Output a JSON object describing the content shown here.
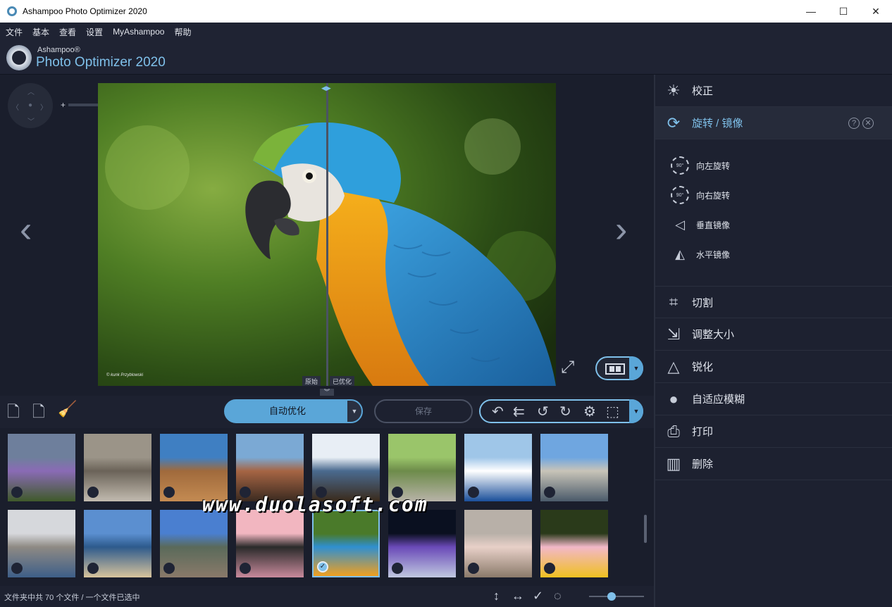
{
  "window": {
    "title": "Ashampoo Photo Optimizer 2020",
    "controls": [
      "—",
      "☐",
      "✕"
    ]
  },
  "menu": [
    "文件",
    "基本",
    "查看",
    "设置",
    "MyAshampoo",
    "帮助"
  ],
  "brand": {
    "small": "Ashampoo®",
    "big": "Photo Optimizer 2020"
  },
  "viewer": {
    "label_original": "原始",
    "label_optimized": "已优化",
    "credit": "© kunk Przyblowski",
    "zoom_plus": "+",
    "zoom_minus": "−",
    "zoom_level": 0.4
  },
  "toolbar": {
    "auto_label": "自动优化",
    "save_label": "保存"
  },
  "thumbnails": [
    {
      "name": "thumb-village-flowers",
      "colors": [
        "#6e7f9c",
        "#8a6bb5",
        "#3f5a2a"
      ]
    },
    {
      "name": "thumb-monkeys",
      "colors": [
        "#9b9488",
        "#6b6358",
        "#c2bbb0"
      ]
    },
    {
      "name": "thumb-horses-desert",
      "colors": [
        "#3f7fc2",
        "#a06a3c",
        "#c48b52"
      ]
    },
    {
      "name": "thumb-donkey-pack",
      "colors": [
        "#7ba9d4",
        "#a66544",
        "#3a2a20"
      ]
    },
    {
      "name": "thumb-greek-horses",
      "colors": [
        "#e8eef5",
        "#4a6a8f",
        "#3a2a1a"
      ]
    },
    {
      "name": "thumb-path-trees",
      "colors": [
        "#9ac56a",
        "#6d8b4a",
        "#b8b3a8"
      ]
    },
    {
      "name": "thumb-blue-dome",
      "colors": [
        "#9fc6e8",
        "#ffffff",
        "#1a4f9a"
      ]
    },
    {
      "name": "thumb-old-truck",
      "colors": [
        "#6fa6e0",
        "#c8c4b8",
        "#4a5a6a"
      ]
    },
    {
      "name": "thumb-colonial-building",
      "colors": [
        "#d6d8dc",
        "#8e8a84",
        "#3e5f88"
      ]
    },
    {
      "name": "thumb-blue-car",
      "colors": [
        "#5b8fd0",
        "#2d5a8c",
        "#d8c49c"
      ]
    },
    {
      "name": "thumb-green-truck",
      "colors": [
        "#4a7fd0",
        "#5a6a5a",
        "#8a7a6a"
      ]
    },
    {
      "name": "thumb-palm-sunset",
      "colors": [
        "#f2b6c0",
        "#2a2a2a",
        "#c88a9c"
      ]
    },
    {
      "name": "thumb-parrot",
      "colors": [
        "#4a7a2a",
        "#2f8fd0",
        "#f0a020"
      ],
      "selected": true
    },
    {
      "name": "thumb-towers-night",
      "colors": [
        "#0a1020",
        "#6a4ab8",
        "#c0c8e0"
      ]
    },
    {
      "name": "thumb-piglet",
      "colors": [
        "#b8b0a8",
        "#e8d0c8",
        "#8a7a6a"
      ]
    },
    {
      "name": "thumb-pink-flower",
      "colors": [
        "#2a3a1a",
        "#f2b8c8",
        "#f0c020"
      ]
    }
  ],
  "watermark": "www.duolasoft.com",
  "status": {
    "text": "文件夹中共 70 个文件 / 一个文件已选中",
    "zoom_level": 0.4
  },
  "panel": {
    "items": [
      {
        "label": "校正",
        "icon": "brightness-icon",
        "glyph": "☀"
      },
      {
        "label": "旋转 / 镜像",
        "icon": "rotate-icon",
        "glyph": "⟳",
        "active": true
      },
      {
        "label": "切割",
        "icon": "crop-icon",
        "glyph": "⌗"
      },
      {
        "label": "调整大小",
        "icon": "resize-icon",
        "glyph": "⇲"
      },
      {
        "label": "锐化",
        "icon": "sharpen-icon",
        "glyph": "△"
      },
      {
        "label": "自适应模糊",
        "icon": "blur-drop-icon",
        "glyph": "💧"
      },
      {
        "label": "打印",
        "icon": "print-icon",
        "glyph": "⎙"
      },
      {
        "label": "删除",
        "icon": "trash-icon",
        "glyph": "🗑"
      }
    ],
    "sub_items": [
      {
        "label": "向左旋转",
        "icon": "rotate-left-90-icon",
        "badge": "90°"
      },
      {
        "label": "向右旋转",
        "icon": "rotate-right-90-icon",
        "badge": "90°"
      },
      {
        "label": "垂直镜像",
        "icon": "flip-vertical-icon",
        "glyph": "◁"
      },
      {
        "label": "水平镜像",
        "icon": "flip-horizontal-icon",
        "glyph": "◭"
      }
    ],
    "help": "?",
    "close": "✕"
  },
  "colors": {
    "accent": "#7fc0ea",
    "accent_fill": "#5aa6d8",
    "background": "#1d2130",
    "panel_active": "#262b3a"
  }
}
